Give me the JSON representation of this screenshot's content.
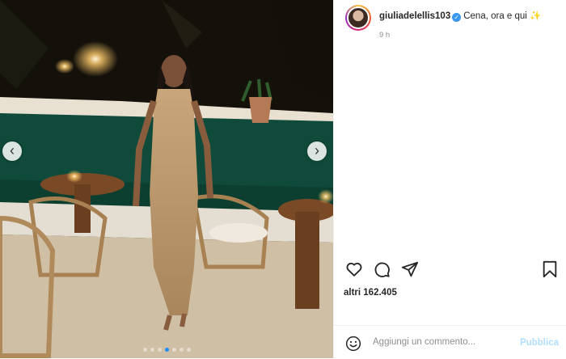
{
  "post": {
    "username": "giuliadelellis103",
    "verified_mark": "✓",
    "caption": "Cena, ora e qui",
    "caption_emoji": "✨",
    "time": "9 h",
    "likes": "altri 162.405"
  },
  "media": {
    "prev_icon": "‹",
    "next_icon": "›",
    "carousel_dots": 7,
    "active_dot": 4
  },
  "comment": {
    "placeholder": "Aggiungi un commento...",
    "publish_label": "Pubblica"
  },
  "colors": {
    "text": "#262626",
    "muted": "#8e8e8e",
    "link_disabled": "#b2dffc",
    "active_dot": "#1f8fff",
    "verified": "#3897f0"
  }
}
